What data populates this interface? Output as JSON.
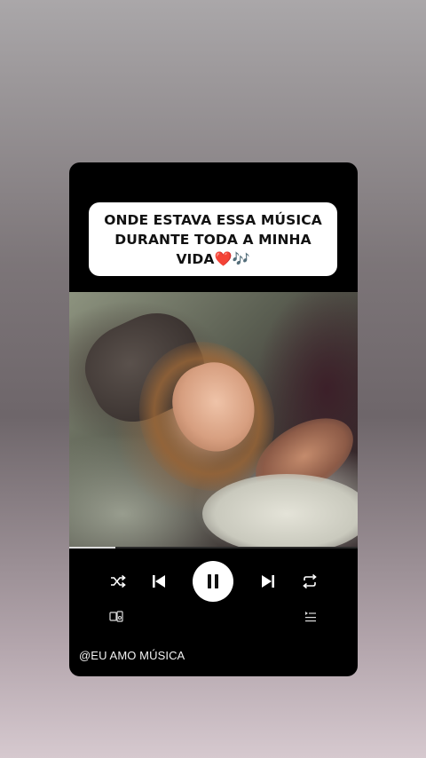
{
  "caption": {
    "line1": "ONDE ESTAVA ESSA MÚSICA",
    "line2": "DURANTE TODA A MINHA",
    "line3": "VIDA",
    "emoji_heart": "❤️",
    "emoji_notes": "🎶"
  },
  "player": {
    "progress_fraction": 0.16,
    "state": "playing",
    "icons": {
      "shuffle": "shuffle-icon",
      "previous": "skip-previous-icon",
      "play_pause": "pause-icon",
      "next": "skip-next-icon",
      "repeat": "repeat-icon",
      "devices": "connect-devices-icon",
      "queue": "queue-icon"
    }
  },
  "handle": "@EU AMO MÚSICA",
  "colors": {
    "card_background": "#000000",
    "caption_background": "#ffffff",
    "control_color": "#ffffff"
  }
}
